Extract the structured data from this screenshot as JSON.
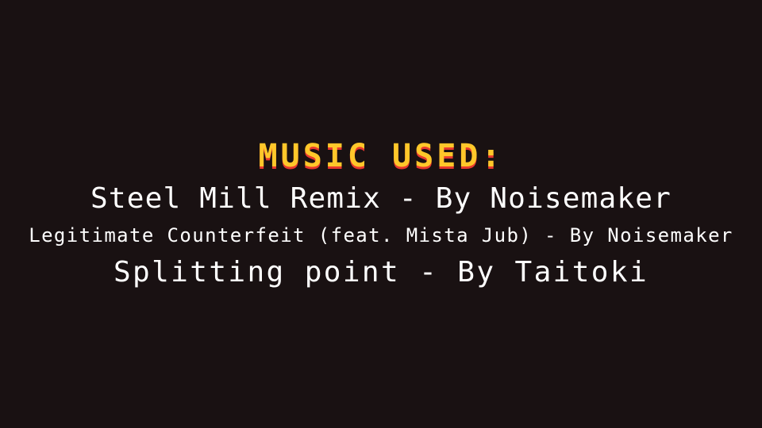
{
  "credits": {
    "heading": "MUSIC USED:",
    "tracks": [
      "Steel Mill Remix - By Noisemaker",
      "Legitimate Counterfeit (feat. Mista Jub) - By Noisemaker",
      "Splitting point - By Taitoki"
    ]
  },
  "colors": {
    "background": "#191112",
    "heading": "#ffc72a",
    "heading_shadow": "#e8392e",
    "text": "#ffffff"
  }
}
